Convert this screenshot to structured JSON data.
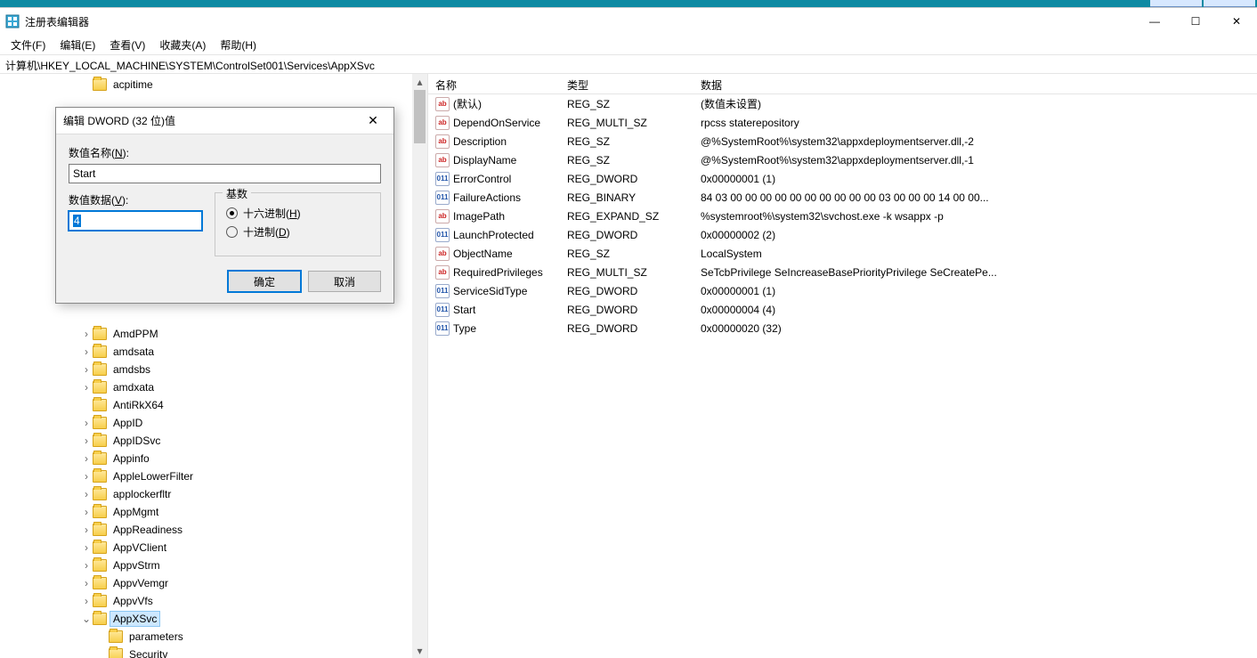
{
  "window": {
    "title": "注册表编辑器",
    "sys_min": "—",
    "sys_max": "☐",
    "sys_close": "✕"
  },
  "menu": {
    "file": "文件(F)",
    "edit": "编辑(E)",
    "view": "查看(V)",
    "favorites": "收藏夹(A)",
    "help": "帮助(H)"
  },
  "address": "计算机\\HKEY_LOCAL_MACHINE\\SYSTEM\\ControlSet001\\Services\\AppXSvc",
  "tree": [
    {
      "indent": 5,
      "expander": "",
      "label": "acpitime"
    },
    {
      "indent": 5,
      "expander": "›",
      "label": "AmdPPM"
    },
    {
      "indent": 5,
      "expander": "›",
      "label": "amdsata"
    },
    {
      "indent": 5,
      "expander": "›",
      "label": "amdsbs"
    },
    {
      "indent": 5,
      "expander": "›",
      "label": "amdxata"
    },
    {
      "indent": 5,
      "expander": "",
      "label": "AntiRkX64"
    },
    {
      "indent": 5,
      "expander": "›",
      "label": "AppID"
    },
    {
      "indent": 5,
      "expander": "›",
      "label": "AppIDSvc"
    },
    {
      "indent": 5,
      "expander": "›",
      "label": "Appinfo"
    },
    {
      "indent": 5,
      "expander": "›",
      "label": "AppleLowerFilter"
    },
    {
      "indent": 5,
      "expander": "›",
      "label": "applockerfltr"
    },
    {
      "indent": 5,
      "expander": "›",
      "label": "AppMgmt"
    },
    {
      "indent": 5,
      "expander": "›",
      "label": "AppReadiness"
    },
    {
      "indent": 5,
      "expander": "›",
      "label": "AppVClient"
    },
    {
      "indent": 5,
      "expander": "›",
      "label": "AppvStrm"
    },
    {
      "indent": 5,
      "expander": "›",
      "label": "AppvVemgr"
    },
    {
      "indent": 5,
      "expander": "›",
      "label": "AppvVfs"
    },
    {
      "indent": 5,
      "expander": "⌄",
      "label": "AppXSvc",
      "selected": true
    },
    {
      "indent": 6,
      "expander": "",
      "label": "parameters"
    },
    {
      "indent": 6,
      "expander": "",
      "label": "Security"
    }
  ],
  "list": {
    "headers": {
      "name": "名称",
      "type": "类型",
      "data": "数据"
    },
    "rows": [
      {
        "icon": "str",
        "name": "(默认)",
        "type": "REG_SZ",
        "data": "(数值未设置)"
      },
      {
        "icon": "str",
        "name": "DependOnService",
        "type": "REG_MULTI_SZ",
        "data": "rpcss staterepository"
      },
      {
        "icon": "str",
        "name": "Description",
        "type": "REG_SZ",
        "data": "@%SystemRoot%\\system32\\appxdeploymentserver.dll,-2"
      },
      {
        "icon": "str",
        "name": "DisplayName",
        "type": "REG_SZ",
        "data": "@%SystemRoot%\\system32\\appxdeploymentserver.dll,-1"
      },
      {
        "icon": "bin",
        "name": "ErrorControl",
        "type": "REG_DWORD",
        "data": "0x00000001 (1)"
      },
      {
        "icon": "bin",
        "name": "FailureActions",
        "type": "REG_BINARY",
        "data": "84 03 00 00 00 00 00 00 00 00 00 00 03 00 00 00 14 00 00..."
      },
      {
        "icon": "str",
        "name": "ImagePath",
        "type": "REG_EXPAND_SZ",
        "data": "%systemroot%\\system32\\svchost.exe -k wsappx -p"
      },
      {
        "icon": "bin",
        "name": "LaunchProtected",
        "type": "REG_DWORD",
        "data": "0x00000002 (2)"
      },
      {
        "icon": "str",
        "name": "ObjectName",
        "type": "REG_SZ",
        "data": "LocalSystem"
      },
      {
        "icon": "str",
        "name": "RequiredPrivileges",
        "type": "REG_MULTI_SZ",
        "data": "SeTcbPrivilege SeIncreaseBasePriorityPrivilege SeCreatePe..."
      },
      {
        "icon": "bin",
        "name": "ServiceSidType",
        "type": "REG_DWORD",
        "data": "0x00000001 (1)"
      },
      {
        "icon": "bin",
        "name": "Start",
        "type": "REG_DWORD",
        "data": "0x00000004 (4)"
      },
      {
        "icon": "bin",
        "name": "Type",
        "type": "REG_DWORD",
        "data": "0x00000020 (32)"
      }
    ]
  },
  "dialog": {
    "title": "编辑 DWORD (32 位)值",
    "name_label_pre": "数值名称(",
    "name_label_u": "N",
    "name_label_post": "):",
    "name_value": "Start",
    "data_label_pre": "数值数据(",
    "data_label_u": "V",
    "data_label_post": "):",
    "data_value": "4",
    "base_label": "基数",
    "hex_pre": "十六进制(",
    "hex_u": "H",
    "hex_post": ")",
    "dec_pre": "十进制(",
    "dec_u": "D",
    "dec_post": ")",
    "ok": "确定",
    "cancel": "取消",
    "close_x": "✕"
  },
  "icons": {
    "str_glyph": "ab",
    "bin_glyph": "011"
  }
}
